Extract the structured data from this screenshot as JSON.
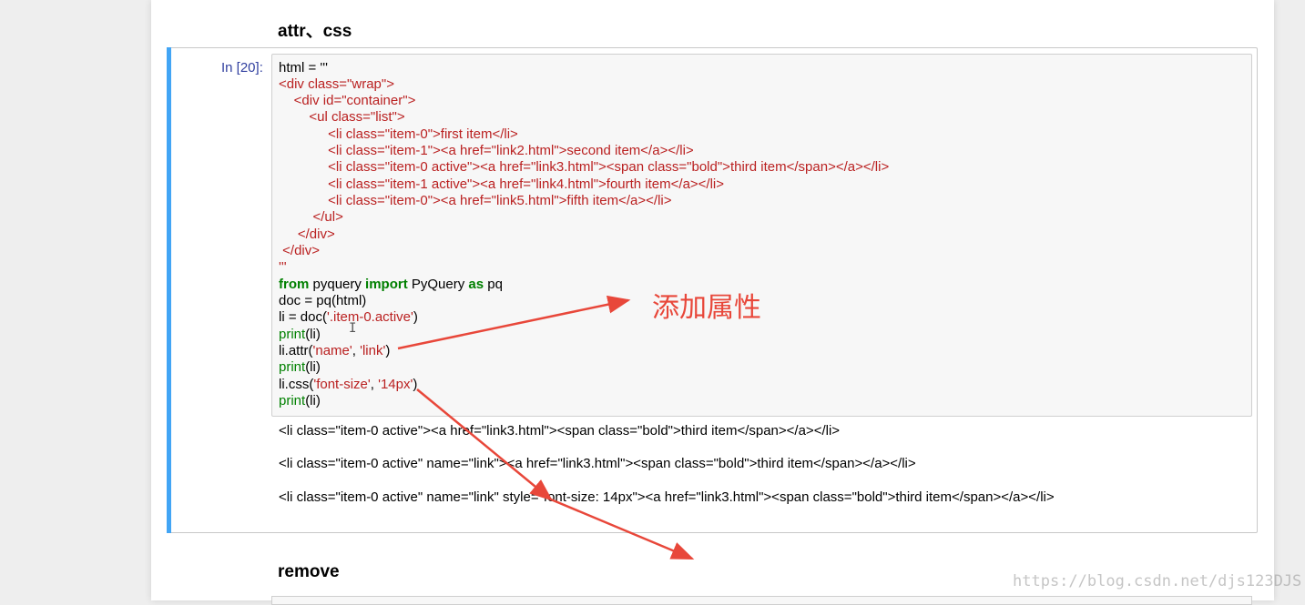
{
  "section_attr_title": "attr、css",
  "section_remove_title": "remove",
  "cell": {
    "prompt": "In [20]:",
    "code": {
      "l1": "html = '''",
      "l2": "<div class=\"wrap\">",
      "l3": "    <div id=\"container\">",
      "l4": "        <ul class=\"list\">",
      "l5": "             <li class=\"item-0\">first item</li>",
      "l6": "             <li class=\"item-1\"><a href=\"link2.html\">second item</a></li>",
      "l7": "             <li class=\"item-0 active\"><a href=\"link3.html\"><span class=\"bold\">third item</span></a></li>",
      "l8": "             <li class=\"item-1 active\"><a href=\"link4.html\">fourth item</a></li>",
      "l9": "             <li class=\"item-0\"><a href=\"link5.html\">fifth item</a></li>",
      "l10": "         </ul>",
      "l11": "     </div>",
      "l12": " </div>",
      "l13": "'''",
      "l14_kw1": "from",
      "l14_mid": " pyquery ",
      "l14_kw2": "import",
      "l14_mid2": " PyQuery ",
      "l14_kw3": "as",
      "l14_end": " pq",
      "l15": "doc = pq(html)",
      "l16_a": "li = doc(",
      "l16_s": "'.item-0.active'",
      "l16_b": ")",
      "l17_fn": "print",
      "l17_arg": "(li)",
      "l18_a": "li.attr(",
      "l18_s1": "'name'",
      "l18_c": ", ",
      "l18_s2": "'link'",
      "l18_b": ")",
      "l19_fn": "print",
      "l19_arg": "(li)",
      "l20_a": "li.css(",
      "l20_s1": "'font-size'",
      "l20_c": ", ",
      "l20_s2": "'14px'",
      "l20_b": ")",
      "l21_fn": "print",
      "l21_arg": "(li)"
    },
    "output": [
      "<li class=\"item-0 active\"><a href=\"link3.html\"><span class=\"bold\">third item</span></a></li>",
      "<li class=\"item-0 active\" name=\"link\"><a href=\"link3.html\"><span class=\"bold\">third item</span></a></li>",
      "<li class=\"item-0 active\" name=\"link\" style=\"font-size: 14px\"><a href=\"link3.html\"><span class=\"bold\">third item</span></a></li>"
    ]
  },
  "annotation": "添加属性",
  "cursor_glyph": "I",
  "watermark": "https://blog.csdn.net/djs123DJS",
  "colors": {
    "cell_selected_bar": "#42a5f5",
    "string": "#ba2121",
    "keyword": "#008000",
    "annotation": "#e8473a"
  }
}
